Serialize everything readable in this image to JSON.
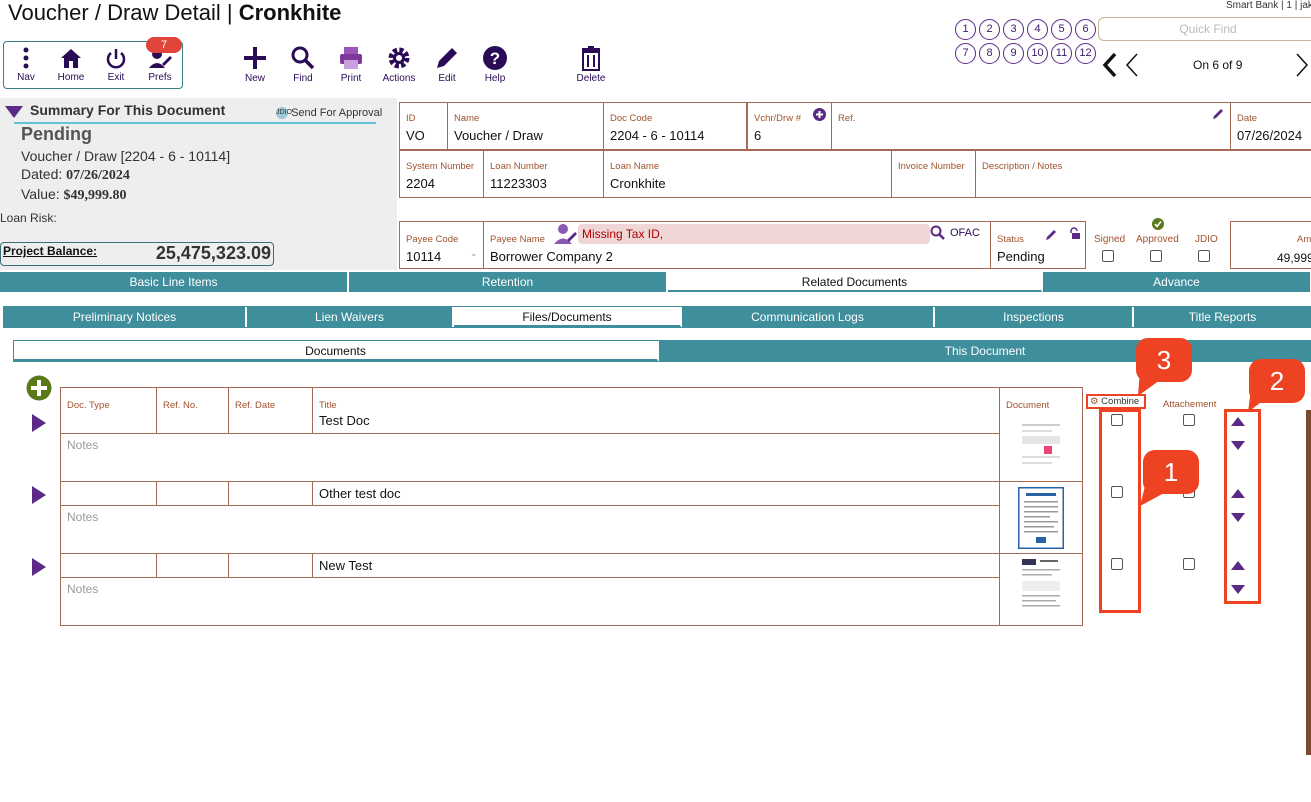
{
  "header": {
    "title_prefix": "Voucher / Draw Detail | ",
    "title_name": "Cronkhite",
    "user_info": "Smart Bank | 1 | jak"
  },
  "nav_cluster": {
    "nav": "Nav",
    "home": "Home",
    "exit": "Exit",
    "prefs": "Prefs",
    "prefs_badge": "7"
  },
  "toolbar": {
    "new": "New",
    "find": "Find",
    "print": "Print",
    "actions": "Actions",
    "edit": "Edit",
    "help": "Help",
    "delete": "Delete"
  },
  "circles": [
    "1",
    "2",
    "3",
    "4",
    "5",
    "6",
    "7",
    "8",
    "9",
    "10",
    "11",
    "12"
  ],
  "quick_find": {
    "placeholder": "Quick Find"
  },
  "record_position": "On 6 of 9",
  "summary": {
    "heading": "Summary For This Document",
    "send_for_approval": "Send For Approval",
    "jdio_label": "JDIO",
    "status": "Pending",
    "doc_line": "Voucher / Draw  [2204 - 6 - 10114]",
    "dated_label": "Dated: ",
    "dated_value": "07/26/2024",
    "value_label": "Value: ",
    "value_value": "$49,999.80",
    "loan_risk_label": "Loan Risk:",
    "project_balance_label": "Project Balance:",
    "project_balance_value": "25,475,323.09"
  },
  "fields": {
    "id": {
      "label": "ID",
      "value": "VO"
    },
    "name": {
      "label": "Name",
      "value": "Voucher / Draw"
    },
    "doc_code": {
      "label": "Doc Code",
      "value": "2204 - 6 - 10114"
    },
    "vchr_drw": {
      "label": "Vchr/Drw #",
      "value": "6"
    },
    "ref": {
      "label": "Ref.",
      "value": ""
    },
    "date": {
      "label": "Date",
      "value": "07/26/2024"
    },
    "system_number": {
      "label": "System Number",
      "value": "2204"
    },
    "loan_number": {
      "label": "Loan Number",
      "value": "11223303"
    },
    "loan_name": {
      "label": "Loan Name",
      "value": "Cronkhite"
    },
    "invoice_number": {
      "label": "Invoice Number",
      "value": ""
    },
    "description_notes": {
      "label": "Description / Notes",
      "value": ""
    },
    "payee_code": {
      "label": "Payee Code",
      "value": "10114"
    },
    "payee_name": {
      "label": "Payee Name",
      "value": "Borrower Company 2"
    },
    "payee_alert": "Missing Tax ID,",
    "ofac": "OFAC",
    "status": {
      "label": "Status",
      "value": "Pending"
    },
    "signed": "Signed",
    "approved": "Approved",
    "jdio": "JDIO",
    "amount": {
      "label": "Am",
      "value": "49,999"
    }
  },
  "tabs_main": [
    "Basic Line Items",
    "Retention",
    "Related Documents",
    "Advance"
  ],
  "tabs_sub": [
    "Preliminary Notices",
    "Lien Waivers",
    "Files/Documents",
    "Communication Logs",
    "Inspections",
    "Title Reports"
  ],
  "tabs_doc": [
    "Documents",
    "This Document"
  ],
  "docs_table": {
    "headers": {
      "doc_type": "Doc. Type",
      "ref_no": "Ref. No.",
      "ref_date": "Ref. Date",
      "title": "Title",
      "document": "Document",
      "combine": "Combine",
      "attachment": "Attachement"
    },
    "notes_placeholder": "Notes",
    "rows": [
      {
        "title": "Test Doc"
      },
      {
        "title": "Other test doc"
      },
      {
        "title": "New Test"
      }
    ]
  },
  "callouts": [
    "1",
    "2",
    "3"
  ],
  "colors": {
    "accent_purple": "#5a2a86",
    "tab_teal": "#3f8e9c",
    "field_border": "#a46a55",
    "callout_red": "#ee4322"
  }
}
